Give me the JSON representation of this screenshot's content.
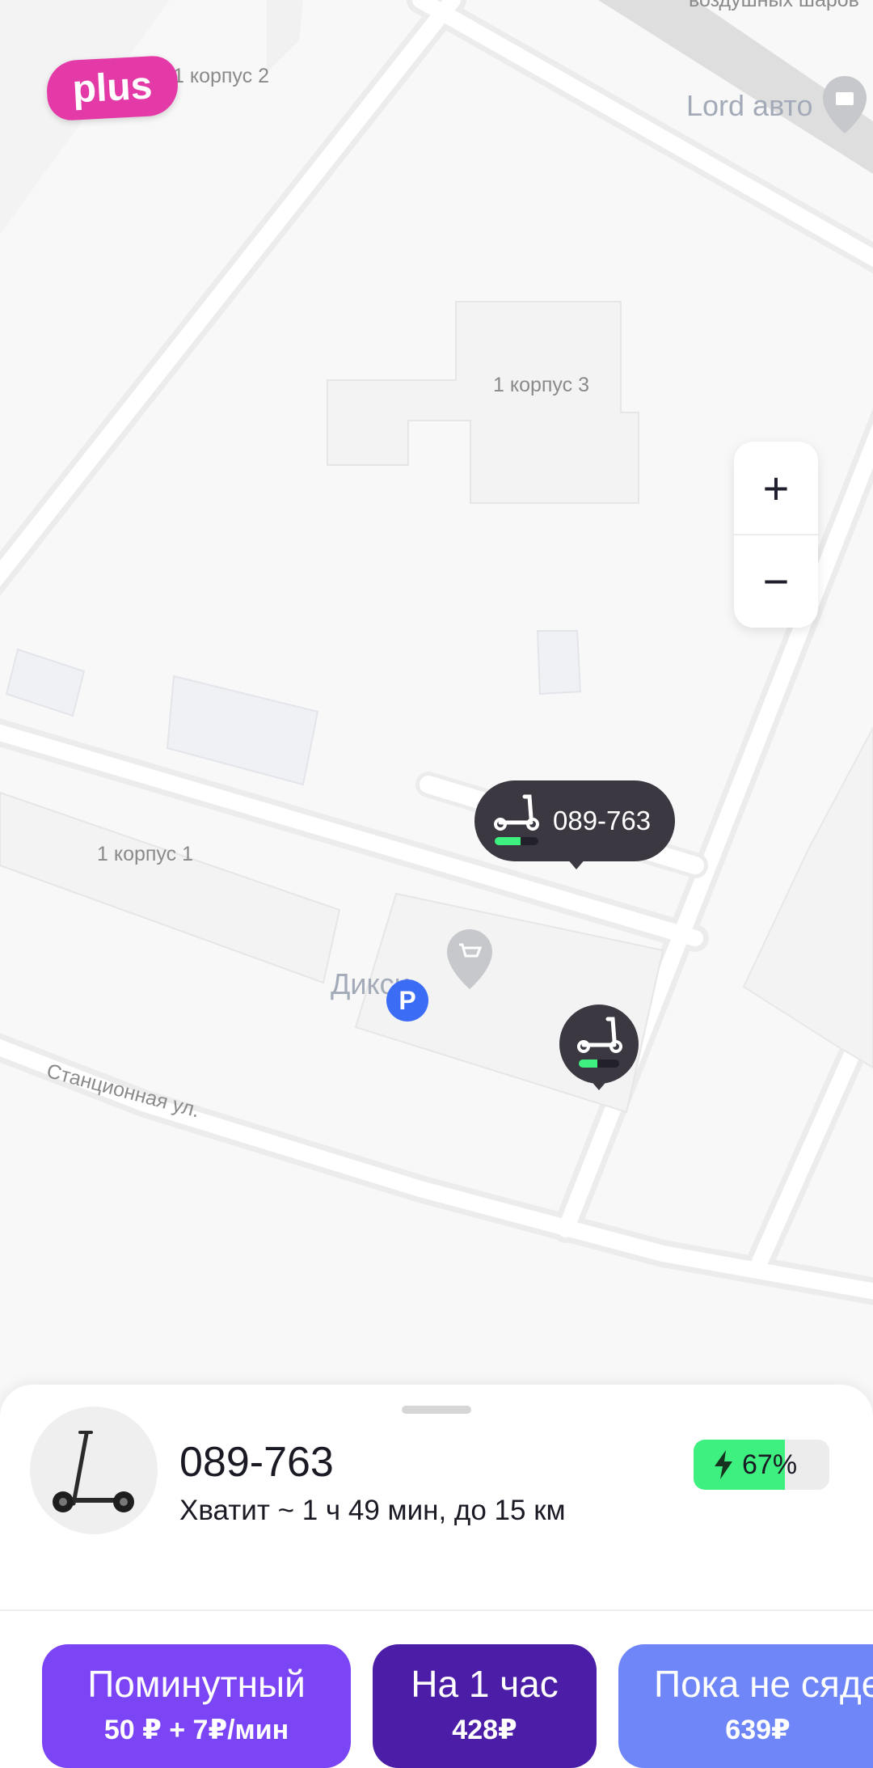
{
  "map": {
    "labels": {
      "korpus2": "1 корпус 2",
      "korpus3": "1 корпус 3",
      "korpus1": "1 корпус 1",
      "street": "Станционная ул.",
      "vozdushnykh": "воздушных шаров",
      "lord_avto": "Lord авто",
      "dixy": "Дикси"
    },
    "plus_badge": "plus",
    "zoom": {
      "in": "+",
      "out": "−"
    },
    "scooter_pin": {
      "code": "089-763",
      "battery_level": 0.6
    },
    "scooter_pin_2": {
      "battery_level": 0.45
    },
    "parking_badge": "P"
  },
  "sheet": {
    "scooter_id": "089-763",
    "range_text": "Хватит ~ 1 ч 49 мин, до 15 км",
    "battery_percent": "67%",
    "battery_level": 0.67,
    "tariffs": [
      {
        "name": "Поминутный",
        "price": "50 ₽ + 7₽/мин",
        "color": "#7b44f5"
      },
      {
        "name": "На 1 час",
        "price": "428₽",
        "color": "#4c1ea8"
      },
      {
        "name": "Пока не сядет",
        "price": "639₽",
        "color": "#6e86f7"
      }
    ]
  },
  "colors": {
    "accent_green": "#3ef07f",
    "plus_pink": "#e43aa8",
    "pin_dark": "#3b3841",
    "parking_blue": "#3b6cf5"
  }
}
